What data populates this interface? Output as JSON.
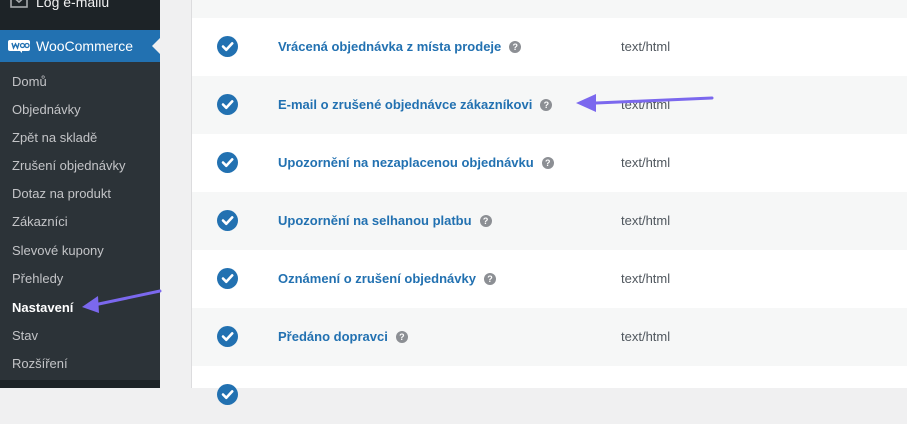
{
  "sidebar": {
    "log_label": "Log e-mailů",
    "woo_label": "WooCommerce",
    "items": [
      {
        "label": "Domů"
      },
      {
        "label": "Objednávky"
      },
      {
        "label": "Zpět na skladě"
      },
      {
        "label": "Zrušení objednávky"
      },
      {
        "label": "Dotaz na produkt"
      },
      {
        "label": "Zákazníci"
      },
      {
        "label": "Slevové kupony"
      },
      {
        "label": "Přehledy"
      },
      {
        "label": "Nastavení"
      },
      {
        "label": "Stav"
      },
      {
        "label": "Rozšíření"
      }
    ]
  },
  "emails": {
    "help_glyph": "?",
    "rows": [
      {
        "name": "Vrácená objednávka z místa prodeje",
        "type": "text/html"
      },
      {
        "name": "E-mail o zrušené objednávce zákazníkovi",
        "type": "text/html"
      },
      {
        "name": "Upozornění na nezaplacenou objednávku",
        "type": "text/html"
      },
      {
        "name": "Upozornění na selhanou platbu",
        "type": "text/html"
      },
      {
        "name": "Oznámení o zrušení objednávky",
        "type": "text/html"
      },
      {
        "name": "Předáno dopravci",
        "type": "text/html"
      }
    ]
  },
  "colors": {
    "accent": "#2271b1",
    "annotation_arrow": "#7b68ee"
  }
}
